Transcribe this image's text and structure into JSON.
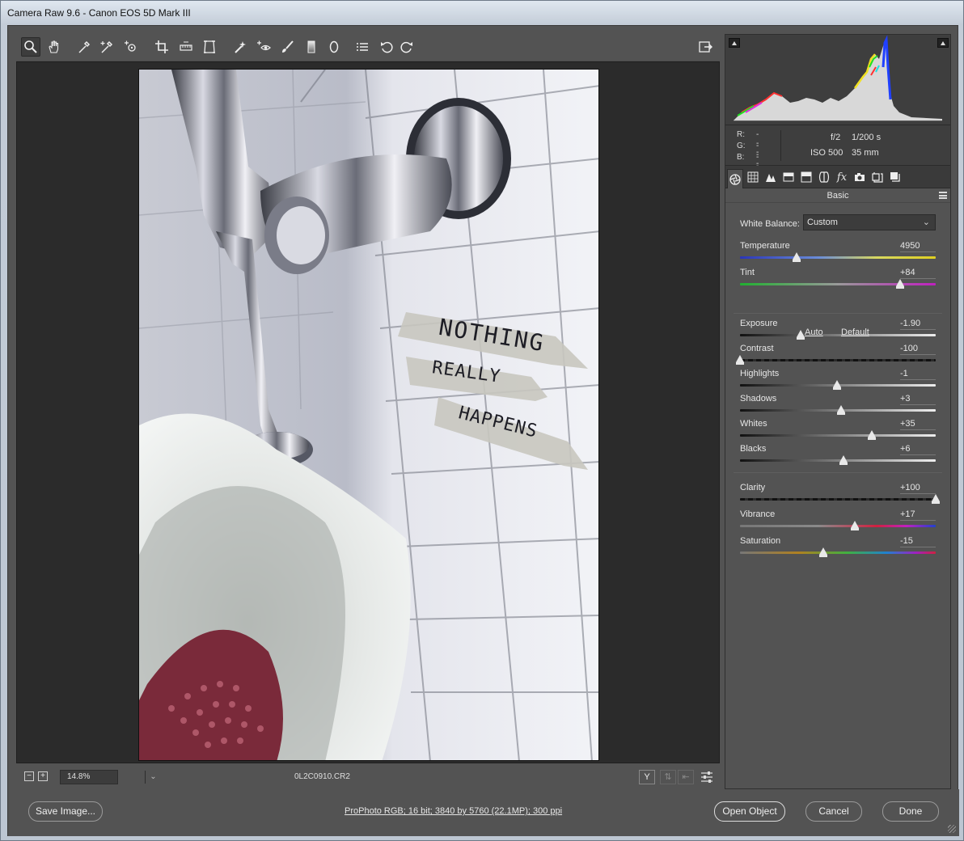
{
  "window": {
    "title": "Camera Raw 9.6  -  Canon EOS 5D Mark III"
  },
  "toolbar": {
    "tools": [
      "zoom-icon",
      "hand-icon",
      "white-balance-icon",
      "color-sampler-icon",
      "target-adjustment-icon",
      "crop-icon",
      "straighten-icon",
      "transform-icon",
      "spot-removal-icon",
      "red-eye-icon",
      "adjustment-brush-icon",
      "graduated-filter-icon",
      "radial-filter-icon",
      "presets-list-icon",
      "rotate-left-icon",
      "rotate-right-icon"
    ],
    "active_tool": "zoom-icon",
    "open_prefs": "open-in-photoshop-icon"
  },
  "photo": {
    "tape_lines": [
      "NOTHING",
      "REALLY",
      "HAPPENS"
    ]
  },
  "statusbar": {
    "zoom": "14.8%",
    "filename": "0L2C0910.CR2"
  },
  "info": {
    "r_label": "R:",
    "r_value": "---",
    "g_label": "G:",
    "g_value": "---",
    "b_label": "B:",
    "b_value": "---",
    "aperture": "f/2",
    "shutter": "1/200 s",
    "iso": "ISO 500",
    "focal": "35 mm"
  },
  "panel": {
    "section_title": "Basic",
    "white_balance_label": "White Balance:",
    "white_balance_value": "Custom",
    "auto_link": "Auto",
    "default_link": "Default",
    "sliders": [
      {
        "label": "Temperature",
        "value": "4950",
        "level": 0.29
      },
      {
        "label": "Tint",
        "value": "+84",
        "level": 0.82
      },
      {
        "label": "Exposure",
        "value": "-1.90",
        "level": 0.31
      },
      {
        "label": "Contrast",
        "value": "-100",
        "level": 0.0
      },
      {
        "label": "Highlights",
        "value": "-1",
        "level": 0.495
      },
      {
        "label": "Shadows",
        "value": "+3",
        "level": 0.515
      },
      {
        "label": "Whites",
        "value": "+35",
        "level": 0.675
      },
      {
        "label": "Blacks",
        "value": "+6",
        "level": 0.53
      },
      {
        "label": "Clarity",
        "value": "+100",
        "level": 1.0
      },
      {
        "label": "Vibrance",
        "value": "+17",
        "level": 0.585
      },
      {
        "label": "Saturation",
        "value": "-15",
        "level": 0.425
      }
    ]
  },
  "bottom": {
    "save_label": "Save Image...",
    "workflow": "ProPhoto RGB; 16 bit; 3840 by 5760 (22.1MP); 300 ppi",
    "open_label": "Open Object",
    "cancel_label": "Cancel",
    "done_label": "Done"
  }
}
